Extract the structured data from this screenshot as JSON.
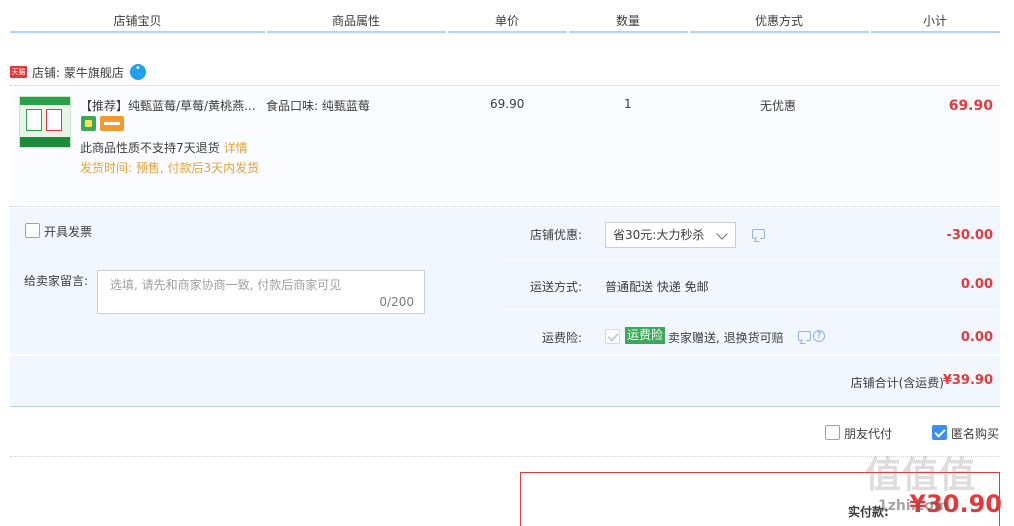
{
  "header": {
    "columns": [
      "店铺宝贝",
      "商品属性",
      "单价",
      "数量",
      "优惠方式",
      "小计"
    ]
  },
  "shop": {
    "badge": "天猫",
    "name": "店铺: 蒙牛旗舰店"
  },
  "item": {
    "title": "【推荐】纯甄蓝莓/草莓/黄桃燕...",
    "attribute": "食品口味: 纯甄蓝莓",
    "price": "69.90",
    "quantity": "1",
    "promotion": "无优惠",
    "subtotal": "69.90",
    "no_return_text": "此商品性质不支持7天退货",
    "no_return_link": "详情",
    "ship_time": "发货时间: 预售, 付款后3天内发货"
  },
  "options": {
    "invoice_label": "开具发票",
    "message_label": "给卖家留言:",
    "message_placeholder": "选填, 请先和商家协商一致, 付款后商家可见",
    "message_count": "0/200",
    "shop_discount_label": "店铺优惠:",
    "shop_discount_value": "省30元:大力秒杀",
    "shop_discount_amount": "-30.00",
    "shipping_label": "运送方式:",
    "shipping_value": "普通配送 快递 免邮",
    "shipping_amount": "0.00",
    "insurance_label": "运费险:",
    "insurance_tag": "运费险",
    "insurance_desc": "卖家赠送, 退换货可赔",
    "insurance_amount": "0.00"
  },
  "totals": {
    "label": "店铺合计(含运费)",
    "amount": "¥39.90"
  },
  "extras": {
    "friend_pay_label": "朋友代付",
    "anonymous_label": "匿名购买",
    "anonymous_checked": true
  },
  "payment": {
    "label": "实付款:",
    "amount": "¥30.90"
  },
  "watermark": {
    "text": "值值值",
    "subtext": "1zhi.com"
  },
  "colors": {
    "price_red": "#e4393c",
    "accent_blue": "#3d8ef0",
    "warning_orange": "#e6a23c",
    "tag_green": "#3aa856",
    "panel_bg": "#f2f7ff"
  }
}
